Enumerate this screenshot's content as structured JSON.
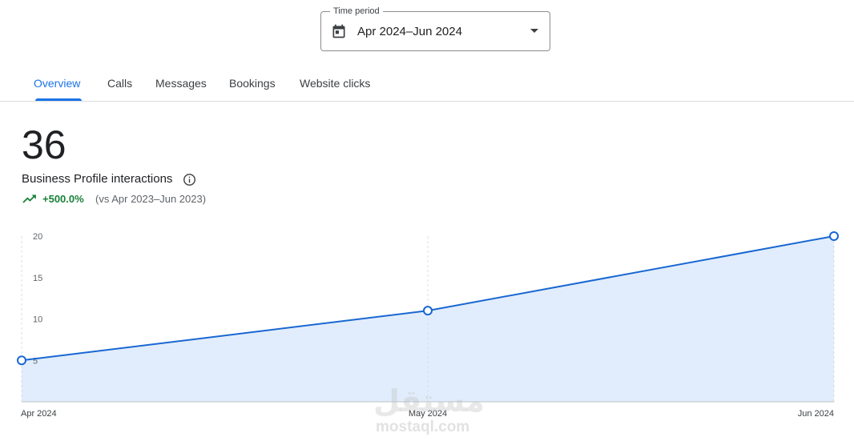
{
  "time_period": {
    "label": "Time period",
    "value": "Apr 2024–Jun 2024"
  },
  "tabs": [
    {
      "label": "Overview",
      "active": true
    },
    {
      "label": "Calls",
      "active": false
    },
    {
      "label": "Messages",
      "active": false
    },
    {
      "label": "Bookings",
      "active": false
    },
    {
      "label": "Website clicks",
      "active": false
    }
  ],
  "metric": {
    "value": "36",
    "label": "Business Profile interactions",
    "change": "+500.0%",
    "comparison": "(vs Apr 2023–Jun 2023)"
  },
  "icons": {
    "calendar": "calendar-icon",
    "dropdown": "chevron-down-icon",
    "info": "info-icon",
    "trend": "trending-up-icon"
  },
  "colors": {
    "accent": "#1a73e8",
    "line": "#1967d2",
    "area": "#e1edfc",
    "positive": "#188038"
  },
  "watermark": {
    "logo": "مستقل",
    "site": "mostaql.com"
  },
  "chart_data": {
    "type": "area",
    "x": [
      "Apr 2024",
      "May 2024",
      "Jun 2024"
    ],
    "series": [
      {
        "values": [
          5,
          11,
          20
        ]
      }
    ],
    "y_ticks": [
      5,
      10,
      15,
      20
    ],
    "ylim": [
      0,
      20
    ],
    "grid": "vertical dashed",
    "legend": "none"
  }
}
